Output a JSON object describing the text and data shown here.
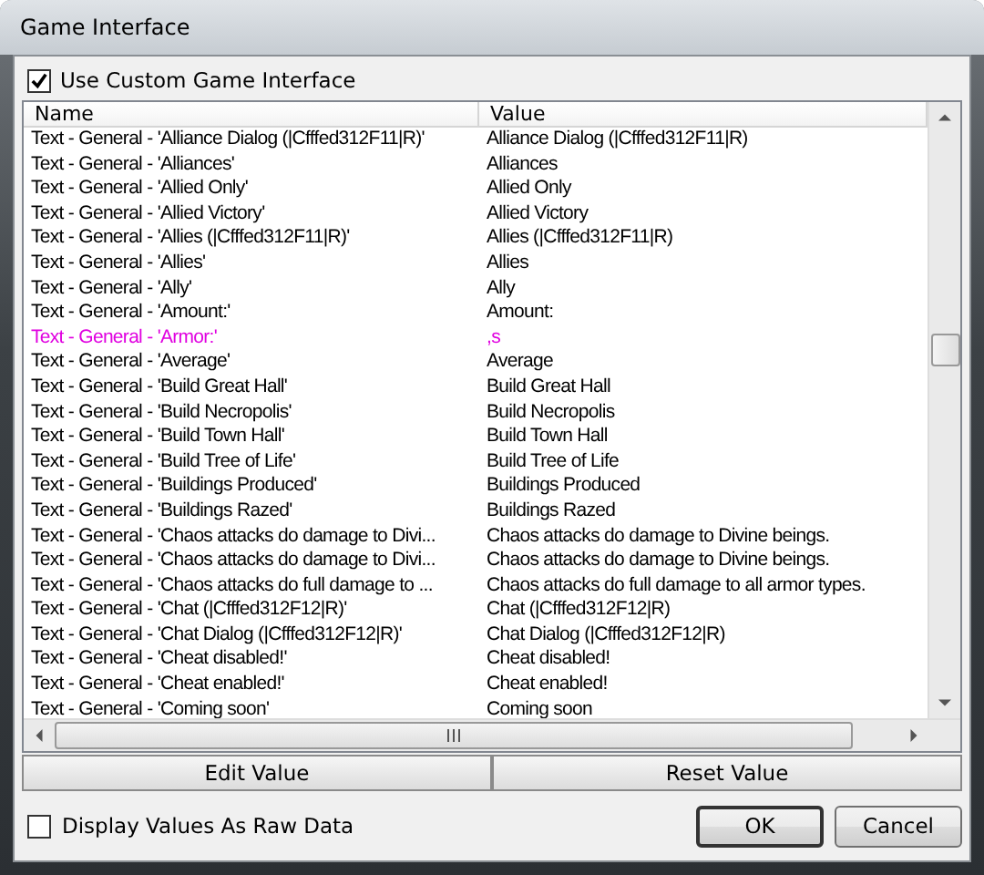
{
  "window": {
    "title": "Game Interface"
  },
  "use_custom": {
    "label": "Use Custom Game Interface",
    "checked": true
  },
  "table": {
    "columns": [
      "Name",
      "Value"
    ],
    "rows": [
      {
        "name": "Text - General - 'Alliance Dialog (|Cfffed312F11|R)'",
        "value": "Alliance Dialog (|Cfffed312F11|R)",
        "modified": false
      },
      {
        "name": "Text - General - 'Alliances'",
        "value": "Alliances",
        "modified": false
      },
      {
        "name": "Text - General - 'Allied Only'",
        "value": "Allied Only",
        "modified": false
      },
      {
        "name": "Text - General - 'Allied Victory'",
        "value": "Allied Victory",
        "modified": false
      },
      {
        "name": "Text - General - 'Allies (|Cfffed312F11|R)'",
        "value": "Allies (|Cfffed312F11|R)",
        "modified": false
      },
      {
        "name": "Text - General - 'Allies'",
        "value": "Allies",
        "modified": false
      },
      {
        "name": "Text - General - 'Ally'",
        "value": "Ally",
        "modified": false
      },
      {
        "name": "Text - General - 'Amount:'",
        "value": "Amount:",
        "modified": false
      },
      {
        "name": "Text - General - 'Armor:'",
        "value": ",s",
        "modified": true
      },
      {
        "name": "Text - General - 'Average'",
        "value": "Average",
        "modified": false
      },
      {
        "name": "Text - General - 'Build Great Hall'",
        "value": "Build Great Hall",
        "modified": false
      },
      {
        "name": "Text - General - 'Build Necropolis'",
        "value": "Build Necropolis",
        "modified": false
      },
      {
        "name": "Text - General - 'Build Town Hall'",
        "value": "Build Town Hall",
        "modified": false
      },
      {
        "name": "Text - General - 'Build Tree of Life'",
        "value": "Build Tree of Life",
        "modified": false
      },
      {
        "name": "Text - General - 'Buildings Produced'",
        "value": "Buildings Produced",
        "modified": false
      },
      {
        "name": "Text - General - 'Buildings Razed'",
        "value": "Buildings Razed",
        "modified": false
      },
      {
        "name": "Text - General - 'Chaos attacks do damage to Divi...",
        "value": "Chaos attacks do damage to Divine beings.",
        "modified": false
      },
      {
        "name": "Text - General - 'Chaos attacks do damage to Divi...",
        "value": "Chaos attacks do damage to Divine beings.",
        "modified": false
      },
      {
        "name": "Text - General - 'Chaos attacks do full damage to ...",
        "value": "Chaos attacks do full damage to all armor types.",
        "modified": false
      },
      {
        "name": "Text - General - 'Chat (|Cfffed312F12|R)'",
        "value": "Chat (|Cfffed312F12|R)",
        "modified": false
      },
      {
        "name": "Text - General - 'Chat Dialog (|Cfffed312F12|R)'",
        "value": "Chat Dialog (|Cfffed312F12|R)",
        "modified": false
      },
      {
        "name": "Text - General - 'Cheat disabled!'",
        "value": "Cheat disabled!",
        "modified": false
      },
      {
        "name": "Text - General - 'Cheat enabled!'",
        "value": "Cheat enabled!",
        "modified": false
      },
      {
        "name": "Text - General - 'Coming soon'",
        "value": "Coming soon",
        "modified": false
      }
    ]
  },
  "actions": [
    "Edit Value",
    "Reset Value"
  ],
  "raw_data": {
    "label": "Display Values As Raw Data",
    "checked": false
  },
  "buttons": [
    {
      "label": "OK",
      "default": true
    },
    {
      "label": "Cancel",
      "default": false
    }
  ]
}
